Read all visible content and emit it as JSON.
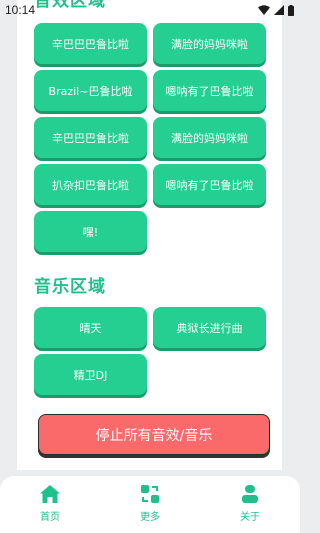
{
  "status_bar": {
    "time": "10:14"
  },
  "sections": {
    "sound_effects_title": "音效区域",
    "music_title": "音乐区域"
  },
  "sound_buttons": [
    "辛巴巴巴鲁比啦",
    "满脸的妈妈咪啦",
    "Brazil~巴鲁比啦",
    "嗯呐有了巴鲁比啦",
    "辛巴巴巴鲁比啦",
    "满脸的妈妈咪啦",
    "扒杂扣巴鲁比啦",
    "嗯呐有了巴鲁比啦",
    "嘿!"
  ],
  "music_buttons": [
    "晴天",
    "典狱长进行曲",
    "精卫DJ"
  ],
  "stop_button": "停止所有音效/音乐",
  "tabbar": {
    "items": [
      {
        "label": "首页",
        "icon": "home-icon"
      },
      {
        "label": "更多",
        "icon": "more-icon"
      },
      {
        "label": "关于",
        "icon": "person-icon"
      }
    ]
  },
  "colors": {
    "accent": "#24cf91",
    "accent_text": "#20c08a",
    "stop": "#fa6a6a"
  }
}
